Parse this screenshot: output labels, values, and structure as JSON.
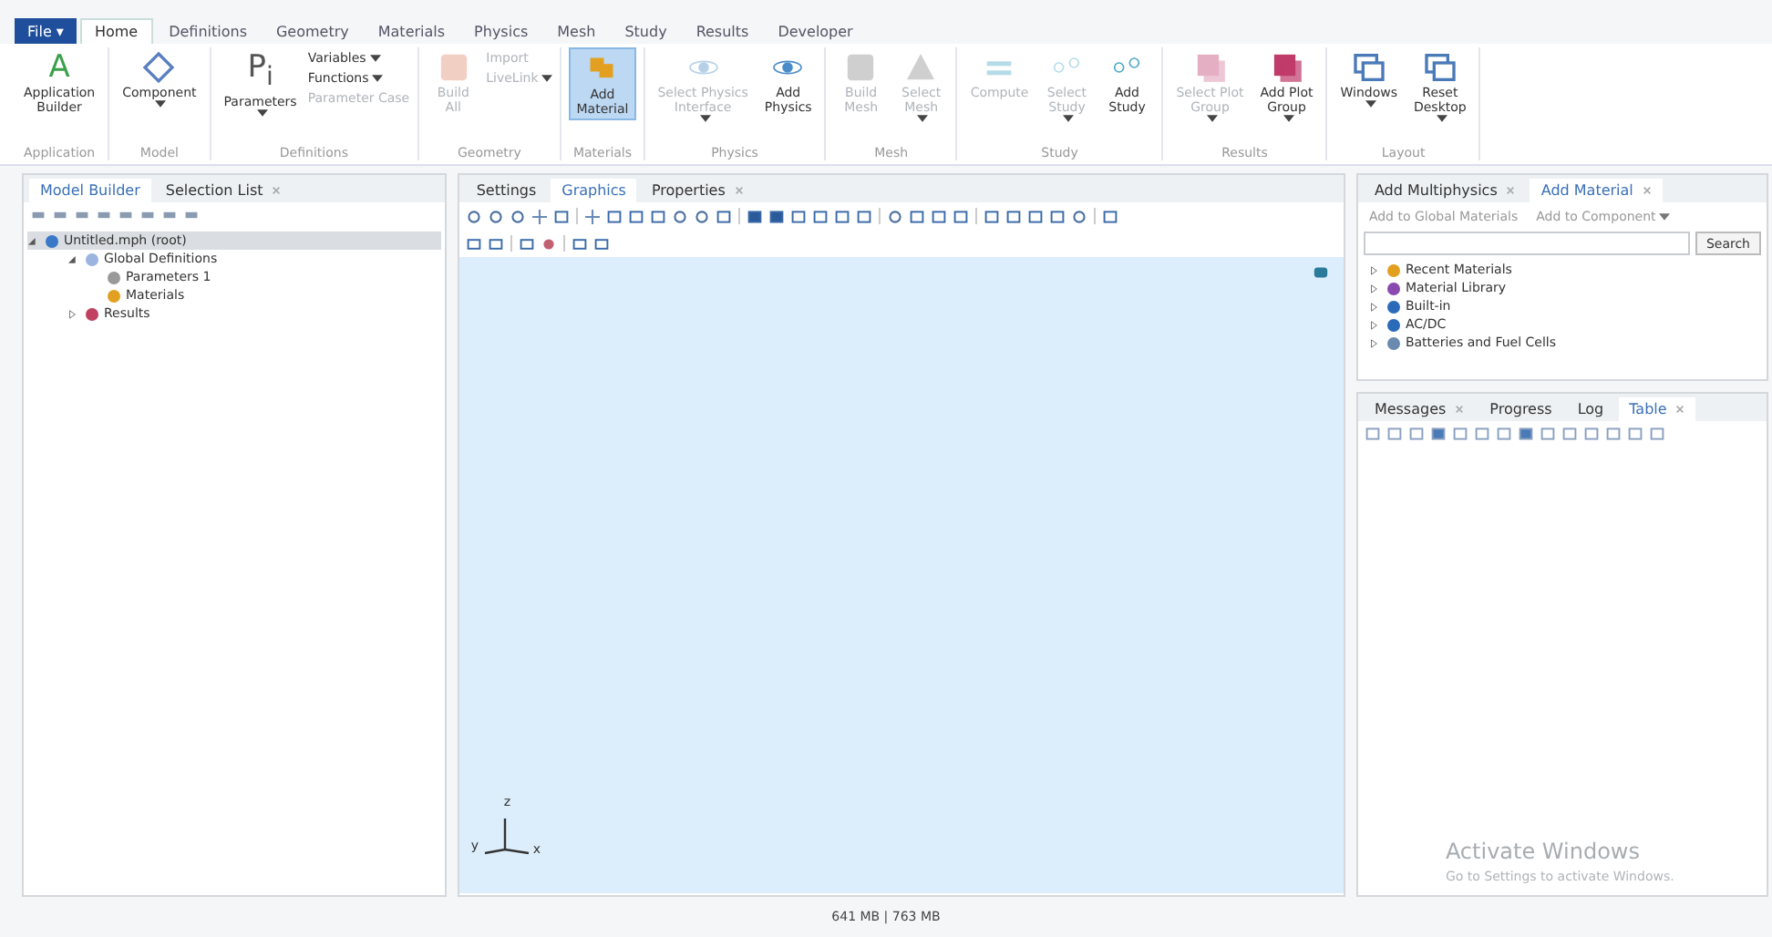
{
  "file_menu": "File ▾",
  "ribbon_tabs": [
    {
      "label": "Home",
      "selected": true
    },
    {
      "label": "Definitions",
      "selected": false
    },
    {
      "label": "Geometry",
      "selected": false
    },
    {
      "label": "Materials",
      "selected": false
    },
    {
      "label": "Physics",
      "selected": false
    },
    {
      "label": "Mesh",
      "selected": false
    },
    {
      "label": "Study",
      "selected": false
    },
    {
      "label": "Results",
      "selected": false
    },
    {
      "label": "Developer",
      "selected": false
    }
  ],
  "ribbon_groups": [
    {
      "label": "Application",
      "buttons": [
        {
          "glyph": "A",
          "lines": [
            "Application",
            "Builder"
          ],
          "dropdown": false,
          "disabled": false,
          "selected": false
        }
      ]
    },
    {
      "label": "Model",
      "buttons": [
        {
          "lines": [
            "Component"
          ],
          "dropdown": true,
          "disabled": false,
          "selected": false
        }
      ]
    },
    {
      "label": "Definitions",
      "buttons": [
        {
          "glyph": "P$_{i}$",
          "lines": [
            "Parameters"
          ],
          "dropdown": true,
          "disabled": false,
          "selected": false
        }
      ],
      "small": [
        {
          "label": "Variables",
          "dropdown": true,
          "disabled": false
        },
        {
          "label": "Functions",
          "dropdown": true,
          "disabled": false
        },
        {
          "label": "Parameter Case",
          "dropdown": false,
          "disabled": true
        }
      ]
    },
    {
      "label": "Geometry",
      "buttons": [
        {
          "lines": [
            "Build",
            "All"
          ],
          "dropdown": false,
          "disabled": true,
          "selected": false
        }
      ],
      "small": [
        {
          "label": "Import",
          "dropdown": false,
          "disabled": true
        },
        {
          "label": "LiveLink",
          "dropdown": true,
          "disabled": true
        }
      ]
    },
    {
      "label": "Materials",
      "buttons": [
        {
          "lines": [
            "Add",
            "Material"
          ],
          "dropdown": false,
          "disabled": false,
          "selected": true
        }
      ]
    },
    {
      "label": "Physics",
      "buttons": [
        {
          "lines": [
            "Select Physics",
            "Interface"
          ],
          "dropdown": true,
          "disabled": true,
          "selected": false
        },
        {
          "lines": [
            "Add",
            "Physics"
          ],
          "dropdown": false,
          "disabled": false,
          "selected": false
        }
      ]
    },
    {
      "label": "Mesh",
      "buttons": [
        {
          "lines": [
            "Build",
            "Mesh"
          ],
          "dropdown": false,
          "disabled": true,
          "selected": false
        },
        {
          "lines": [
            "Select",
            "Mesh"
          ],
          "dropdown": true,
          "disabled": true,
          "selected": false
        }
      ]
    },
    {
      "label": "Study",
      "buttons": [
        {
          "lines": [
            "Compute"
          ],
          "dropdown": false,
          "disabled": true,
          "selected": false
        },
        {
          "lines": [
            "Select",
            "Study"
          ],
          "dropdown": true,
          "disabled": true,
          "selected": false
        },
        {
          "lines": [
            "Add",
            "Study"
          ],
          "dropdown": false,
          "disabled": false,
          "selected": false
        }
      ]
    },
    {
      "label": "Results",
      "buttons": [
        {
          "lines": [
            "Select Plot",
            "Group"
          ],
          "dropdown": true,
          "disabled": true,
          "selected": false
        },
        {
          "lines": [
            "Add Plot",
            "Group"
          ],
          "dropdown": true,
          "disabled": false,
          "selected": false
        }
      ]
    },
    {
      "label": "Layout",
      "buttons": [
        {
          "lines": [
            "Windows"
          ],
          "dropdown": true,
          "disabled": false,
          "selected": false
        },
        {
          "lines": [
            "Reset",
            "Desktop"
          ],
          "dropdown": true,
          "disabled": false,
          "selected": false
        }
      ]
    }
  ],
  "model_panel": {
    "tabs": [
      {
        "label": "Model Builder",
        "selected": true,
        "closable": false
      },
      {
        "label": "Selection List",
        "selected": false,
        "closable": true
      }
    ],
    "tree": [
      {
        "label": "Untitled.mph (root)",
        "expanded": true,
        "selected": true,
        "children": [
          {
            "label": "Global Definitions",
            "expanded": true,
            "selected": false,
            "children": [
              {
                "label": "Parameters 1",
                "selected": false
              },
              {
                "label": "Materials",
                "selected": false
              }
            ]
          },
          {
            "label": "Results",
            "expanded": false,
            "selected": false
          }
        ]
      }
    ]
  },
  "graphics_panel": {
    "tabs": [
      {
        "label": "Settings",
        "selected": false,
        "closable": false
      },
      {
        "label": "Graphics",
        "selected": true,
        "closable": false
      },
      {
        "label": "Properties",
        "selected": false,
        "closable": true
      }
    ],
    "axes": [
      "z",
      "y",
      "x"
    ]
  },
  "material_panel": {
    "tabs": [
      {
        "label": "Add Multiphysics",
        "selected": false,
        "closable": true
      },
      {
        "label": "Add Material",
        "selected": true,
        "closable": true
      }
    ],
    "actions": [
      {
        "label": "Add to Global Materials",
        "disabled": true,
        "dropdown": false
      },
      {
        "label": "Add to Component",
        "disabled": true,
        "dropdown": true
      }
    ],
    "search_button": "Search",
    "items": [
      {
        "label": "Recent Materials",
        "expanded": false
      },
      {
        "label": "Material Library",
        "expanded": false
      },
      {
        "label": "Built-in",
        "expanded": false
      },
      {
        "label": "AC/DC",
        "expanded": false
      },
      {
        "label": "Batteries and Fuel Cells",
        "expanded": false
      }
    ]
  },
  "messages_panel": {
    "tabs": [
      {
        "label": "Messages",
        "selected": false,
        "closable": true
      },
      {
        "label": "Progress",
        "selected": false,
        "closable": false
      },
      {
        "label": "Log",
        "selected": false,
        "closable": false
      },
      {
        "label": "Table",
        "selected": true,
        "closable": true
      }
    ]
  },
  "os_notice": {
    "title": "Activate Windows",
    "text": "Go to Settings to activate Windows."
  },
  "status_bar": "641 MB | 763 MB"
}
